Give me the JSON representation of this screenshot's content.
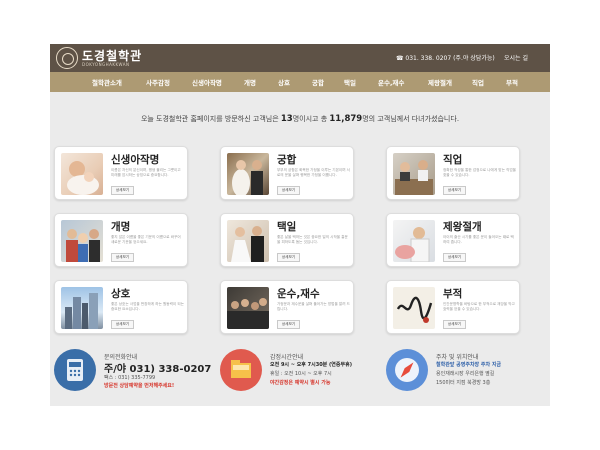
{
  "header": {
    "logo_text": "도경철학관",
    "logo_sub": "DOKYONGHAKKWAN",
    "phone": "☎ 031. 338. 0207 (주.야 상담가능)",
    "directions": "오시는 길"
  },
  "nav": [
    "철학관소개",
    "사주감정",
    "신생아작명",
    "개명",
    "상호",
    "궁합",
    "택일",
    "운수,재수",
    "제왕절개",
    "직업",
    "부적"
  ],
  "welcome": {
    "prefix": "오늘 도경철학관 홈페이지를 방문하신 고객님은",
    "today": "13",
    "middle": "명이시고 총",
    "total": "11,879",
    "suffix": "명의 고객님께서 다녀가셨습니다."
  },
  "services": [
    {
      "title": "신생아작명",
      "desc": "이름은 자신의 분신이며, 평생 불리는 그릇이고 미래를 암시하는 상징으로 중요합니다.",
      "button": "상세보기"
    },
    {
      "title": "궁합",
      "desc": "부부의 궁합은 화목한 가정을 이루는 기본이며 서로의 운을 살펴 행복한 가정을 이룹니다.",
      "button": "상세보기"
    },
    {
      "title": "직업",
      "desc": "정확한 적성을 통한 감정으로 나에게 맞는 직업을 찾을 수 있습니다.",
      "button": "상세보기"
    },
    {
      "title": "개명",
      "desc": "좋지 않은 이름을 좋은 기운의 이름으로 바꾸어 새로운 기운을 얻으세요.",
      "button": "상세보기"
    },
    {
      "title": "택일",
      "desc": "좋은 날을 택하는 것은 중요한 일의 시작을 흉운을 피하도록 돕는 것입니다.",
      "button": "상세보기"
    },
    {
      "title": "제왕절개",
      "desc": "아이의 출산 시기를 좋은 운이 들어오는 때로 택하여 줍니다.",
      "button": "상세보기"
    },
    {
      "title": "상호",
      "desc": "좋은 상호는 사업을 번창하게 하는 원동력이 되는 중요한 요소입니다.",
      "button": "상세보기"
    },
    {
      "title": "운수,재수",
      "desc": "가정운과 재수운을 살펴 풀어가는 방법을 알려 드립니다.",
      "button": "상세보기"
    },
    {
      "title": "부적",
      "desc": "인간운명학을 바탕으로 한 부적으로 재앙을 막고 효력을 얻을 수 있습니다.",
      "button": "상세보기"
    }
  ],
  "bottom": {
    "contact": {
      "title": "문의전화안내",
      "phone": "주/야 031) 338-0207",
      "fax": "팩스 : 031) 335-7799",
      "note": "방문전 상담예약을 먼저해주세요!",
      "icon": "phone-icon",
      "circle_color": "#3a6ea8"
    },
    "hours": {
      "title": "감정시간안내",
      "weekday": "오전 9시 ~ 오후 7시30분 (연중무휴)",
      "holiday": "휴일 : 오전 10시 ~ 오후 7시",
      "note": "야간감정은 예약시 별시 가능",
      "icon": "folder-icon",
      "circle_color": "#e05a4e"
    },
    "location": {
      "title": "주차 및 위치안내",
      "parking": "철학관앞 공영주차장 주차 지금",
      "line1": "용인재래시장 우리은행 옆길",
      "line2": "150미터 지점 북경방 3층",
      "icon": "compass-icon",
      "circle_color": "#5c8fd8"
    }
  },
  "colors": {
    "topbar": "#5e5246",
    "navbar": "#ad9a73",
    "accent_red": "#d6352b",
    "accent_blue": "#2d5fa8"
  }
}
